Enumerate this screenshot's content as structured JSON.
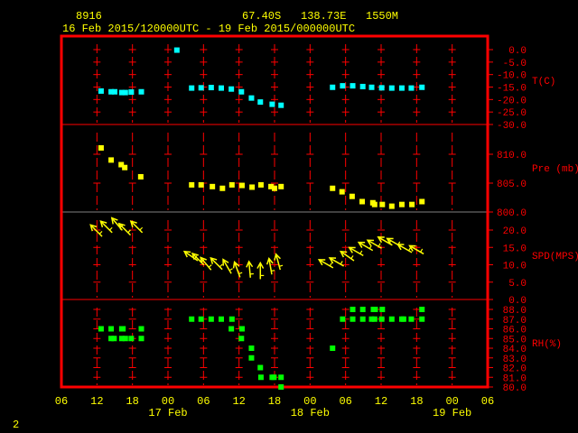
{
  "header": {
    "station": "8916",
    "lat": "67.40S",
    "lon": "138.73E",
    "elev": "1550M",
    "period": "16 Feb 2015/120000UTC - 19 Feb 2015/000000UTC"
  },
  "footer": {
    "page": "2"
  },
  "colors": {
    "frame": "#ff0000",
    "text": "#ffff00",
    "temp": "#00ffff",
    "pres": "#ffff00",
    "wind": "#ffff00",
    "rh": "#00ff00",
    "divider": "#808080"
  },
  "chart_data": {
    "type": "scatter",
    "x_axis": {
      "unit": "hours since 16 Feb 06 UTC",
      "range": [
        0,
        72
      ],
      "tick_labels": [
        "06",
        "12",
        "18",
        "00",
        "06",
        "12",
        "18",
        "00",
        "06",
        "12",
        "18",
        "00",
        "06"
      ],
      "date_labels": [
        {
          "label": "17 Feb",
          "hour": 18
        },
        {
          "label": "18 Feb",
          "hour": 42
        },
        {
          "label": "19 Feb",
          "hour": 66
        }
      ]
    },
    "panels": [
      {
        "name": "temperature",
        "label": "T(C)",
        "ylim": [
          -30,
          0
        ],
        "tick_labels": [
          "0.0",
          "-5.0",
          "-10.0",
          "-15.0",
          "-20.0",
          "-25.0",
          "-30.0"
        ],
        "tick_values": [
          0,
          -5,
          -10,
          -15,
          -20,
          -25,
          -30
        ],
        "points": [
          [
            6.7,
            -16.6
          ],
          [
            8.4,
            -16.9
          ],
          [
            9.0,
            -16.9
          ],
          [
            10.2,
            -17.2
          ],
          [
            10.8,
            -17.2
          ],
          [
            11.8,
            -17.0
          ],
          [
            13.5,
            -16.9
          ],
          [
            19.5,
            -0.2
          ],
          [
            22.0,
            -15.4
          ],
          [
            23.6,
            -15.3
          ],
          [
            25.3,
            -15.2
          ],
          [
            27.0,
            -15.4
          ],
          [
            28.7,
            -15.8
          ],
          [
            30.4,
            -16.9
          ],
          [
            32.1,
            -19.4
          ],
          [
            33.6,
            -21.0
          ],
          [
            35.6,
            -21.9
          ],
          [
            37.1,
            -22.3
          ],
          [
            45.8,
            -15.1
          ],
          [
            47.5,
            -14.5
          ],
          [
            49.2,
            -14.5
          ],
          [
            50.9,
            -14.8
          ],
          [
            52.4,
            -15.1
          ],
          [
            54.1,
            -15.3
          ],
          [
            55.8,
            -15.4
          ],
          [
            57.5,
            -15.4
          ],
          [
            59.1,
            -15.4
          ],
          [
            60.9,
            -15.1
          ]
        ]
      },
      {
        "name": "pressure",
        "label": "Pre (mb)",
        "ylim": [
          800,
          815.2
        ],
        "tick_labels": [
          "810.0",
          "805.0",
          "800.0"
        ],
        "tick_values": [
          810,
          805,
          800
        ],
        "points": [
          [
            6.7,
            811.1
          ],
          [
            8.4,
            809.0
          ],
          [
            10.1,
            808.2
          ],
          [
            10.7,
            807.7
          ],
          [
            13.4,
            806.1
          ],
          [
            22.0,
            804.7
          ],
          [
            23.6,
            804.7
          ],
          [
            25.5,
            804.4
          ],
          [
            27.2,
            804.1
          ],
          [
            28.8,
            804.7
          ],
          [
            30.5,
            804.6
          ],
          [
            32.2,
            804.3
          ],
          [
            33.7,
            804.7
          ],
          [
            35.4,
            804.4
          ],
          [
            36.0,
            804.1
          ],
          [
            37.1,
            804.4
          ],
          [
            45.8,
            804.1
          ],
          [
            47.4,
            803.5
          ],
          [
            49.1,
            802.7
          ],
          [
            50.8,
            801.8
          ],
          [
            52.6,
            801.6
          ],
          [
            52.9,
            801.3
          ],
          [
            54.2,
            801.3
          ],
          [
            55.8,
            801.0
          ],
          [
            57.5,
            801.3
          ],
          [
            59.2,
            801.3
          ],
          [
            60.9,
            801.8
          ]
        ]
      },
      {
        "name": "wind_speed",
        "label": "SPD(MPS)",
        "ylim": [
          0,
          25.2
        ],
        "tick_labels": [
          "20.0",
          "15.0",
          "10.0",
          "5.0",
          "0.0"
        ],
        "tick_values": [
          20,
          15,
          10,
          5,
          0
        ],
        "points": [
          [
            5.9,
            19.8,
            315
          ],
          [
            7.6,
            20.9,
            315
          ],
          [
            9.4,
            21.7,
            320
          ],
          [
            10.7,
            20.2,
            315
          ],
          [
            12.7,
            20.9,
            315
          ],
          [
            21.9,
            12.5,
            305
          ],
          [
            23.1,
            11.6,
            315
          ],
          [
            24.4,
            10.3,
            320
          ],
          [
            26.2,
            10.3,
            315
          ],
          [
            28.0,
            9.5,
            330
          ],
          [
            29.7,
            8.6,
            340
          ],
          [
            31.8,
            8.6,
            355
          ],
          [
            33.6,
            8.2,
            0
          ],
          [
            35.3,
            9.5,
            350
          ],
          [
            36.6,
            10.8,
            345
          ],
          [
            44.7,
            10.3,
            300
          ],
          [
            46.5,
            10.8,
            300
          ],
          [
            48.3,
            12.5,
            305
          ],
          [
            49.8,
            13.8,
            300
          ],
          [
            51.4,
            15.3,
            300
          ],
          [
            52.9,
            15.9,
            300
          ],
          [
            54.7,
            16.8,
            300
          ],
          [
            56.2,
            16.4,
            300
          ],
          [
            58.0,
            14.7,
            300
          ],
          [
            60.0,
            14.3,
            300
          ]
        ]
      },
      {
        "name": "relative_humidity",
        "label": "RH(%)",
        "ylim": [
          80,
          89
        ],
        "tick_labels": [
          "88.0",
          "87.0",
          "86.0",
          "85.0",
          "84.0",
          "83.0",
          "82.0",
          "81.0",
          "80.0"
        ],
        "tick_values": [
          88,
          87,
          86,
          85,
          84,
          83,
          82,
          81,
          80
        ],
        "points": [
          [
            6.7,
            86
          ],
          [
            8.4,
            86
          ],
          [
            10.2,
            86
          ],
          [
            10.4,
            86
          ],
          [
            13.5,
            86
          ],
          [
            8.4,
            85
          ],
          [
            8.9,
            85
          ],
          [
            10.2,
            85
          ],
          [
            10.8,
            85
          ],
          [
            11.8,
            85
          ],
          [
            13.5,
            85
          ],
          [
            22.0,
            87
          ],
          [
            23.6,
            87
          ],
          [
            25.3,
            87
          ],
          [
            27.0,
            87
          ],
          [
            28.8,
            87
          ],
          [
            28.7,
            86
          ],
          [
            30.5,
            86
          ],
          [
            30.4,
            85
          ],
          [
            32.1,
            84
          ],
          [
            32.1,
            83
          ],
          [
            33.6,
            82
          ],
          [
            33.7,
            81
          ],
          [
            35.6,
            81
          ],
          [
            35.9,
            81
          ],
          [
            37.1,
            81
          ],
          [
            37.1,
            80
          ],
          [
            45.8,
            84
          ],
          [
            47.5,
            87
          ],
          [
            49.2,
            87
          ],
          [
            50.9,
            87
          ],
          [
            52.4,
            87
          ],
          [
            52.9,
            87
          ],
          [
            54.1,
            87
          ],
          [
            55.8,
            87
          ],
          [
            57.5,
            87
          ],
          [
            57.8,
            87
          ],
          [
            59.1,
            87
          ],
          [
            60.9,
            87
          ],
          [
            49.2,
            88
          ],
          [
            50.9,
            88
          ],
          [
            52.7,
            88
          ],
          [
            53.0,
            88
          ],
          [
            54.2,
            88
          ],
          [
            60.9,
            88
          ]
        ]
      }
    ]
  }
}
